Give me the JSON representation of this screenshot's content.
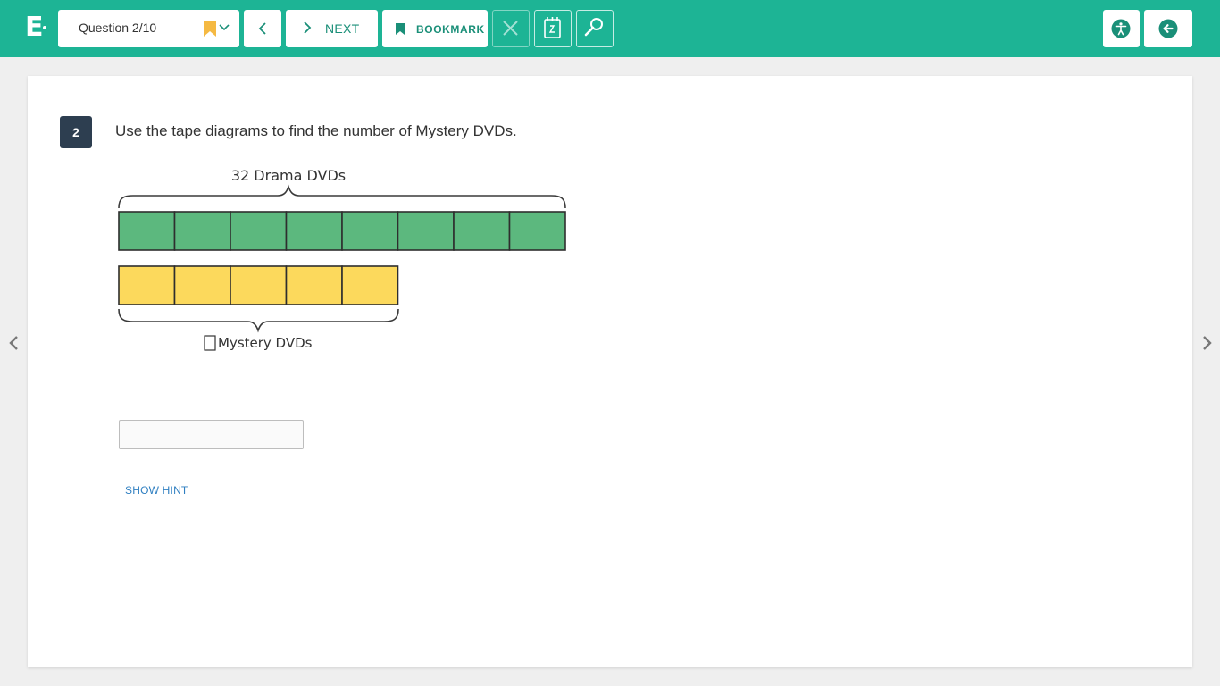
{
  "app": {
    "logo": "E"
  },
  "toolbar": {
    "question_selector": "Question 2/10",
    "next_label": "NEXT",
    "bookmark_label": "BOOKMARK"
  },
  "question": {
    "number": "2",
    "prompt": "Use the tape diagrams to find the number of Mystery DVDs.",
    "answer_value": "",
    "hint_label": "SHOW HINT"
  },
  "diagram": {
    "top_label": "32 Drama DVDs",
    "top_units": 8,
    "bottom_label": "Mystery DVDs",
    "bottom_units": 5
  },
  "colors": {
    "brand": "#1db495",
    "drama_fill": "#5cb87e",
    "mystery_fill": "#fcd95c",
    "bookmark_flag": "#f5b942",
    "question_badge": "#2d3e50",
    "hint_link": "#2f7fc1"
  },
  "icons": {
    "prev": "chevron-left-icon",
    "next": "chevron-right-icon",
    "bookmark": "bookmark-icon",
    "close": "close-icon",
    "calendar": "calendar-icon",
    "search": "magnifier-icon",
    "accessibility": "accessibility-icon",
    "exit": "exit-icon"
  }
}
